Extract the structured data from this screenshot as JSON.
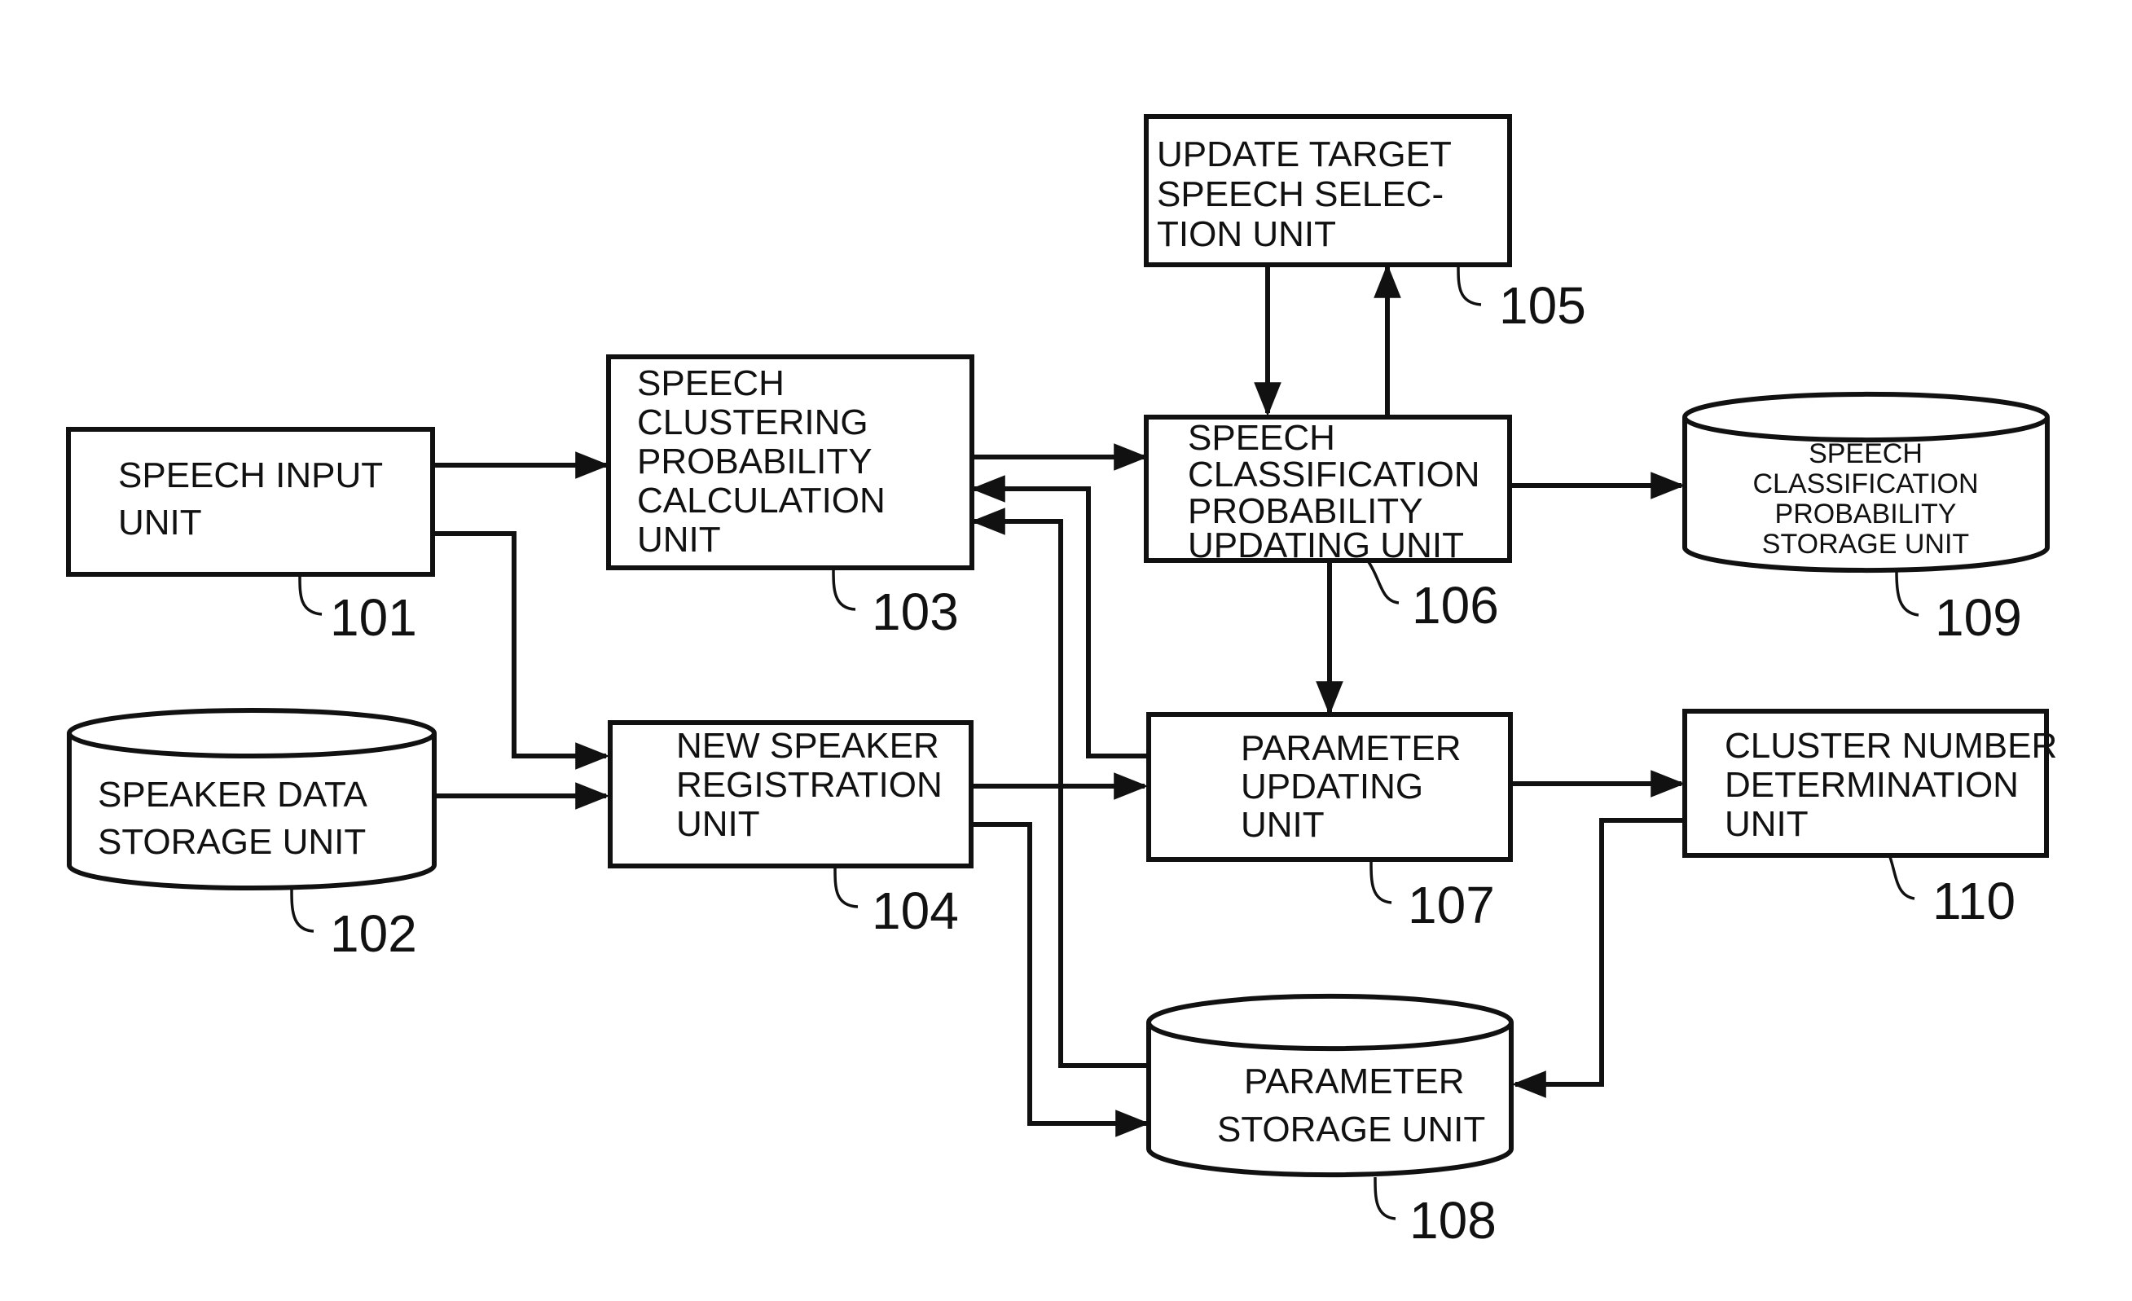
{
  "diagram": {
    "type": "block-diagram",
    "units": [
      {
        "id": "101",
        "shape": "rect",
        "lines": [
          "SPEECH INPUT",
          "UNIT"
        ]
      },
      {
        "id": "102",
        "shape": "cylinder",
        "lines": [
          "SPEAKER DATA",
          "STORAGE UNIT"
        ]
      },
      {
        "id": "103",
        "shape": "rect",
        "lines": [
          "SPEECH",
          "CLUSTERING",
          "PROBABILITY",
          "CALCULATION",
          "UNIT"
        ]
      },
      {
        "id": "104",
        "shape": "rect",
        "lines": [
          "NEW SPEAKER",
          "REGISTRATION",
          "UNIT"
        ]
      },
      {
        "id": "105",
        "shape": "rect",
        "lines": [
          "UPDATE TARGET",
          "SPEECH SELEC-",
          "TION UNIT"
        ]
      },
      {
        "id": "106",
        "shape": "rect",
        "lines": [
          "SPEECH",
          "CLASSIFICATION",
          "PROBABILITY",
          "UPDATING UNIT"
        ]
      },
      {
        "id": "107",
        "shape": "rect",
        "lines": [
          "PARAMETER",
          "UPDATING",
          "UNIT"
        ]
      },
      {
        "id": "108",
        "shape": "cylinder",
        "lines": [
          "PARAMETER",
          "STORAGE UNIT"
        ]
      },
      {
        "id": "109",
        "shape": "cylinder",
        "lines": [
          "SPEECH",
          "CLASSIFICATION",
          "PROBABILITY",
          "STORAGE UNIT"
        ]
      },
      {
        "id": "110",
        "shape": "rect",
        "lines": [
          "CLUSTER NUMBER",
          "DETERMINATION",
          "UNIT"
        ]
      }
    ],
    "connections": [
      {
        "from": "101",
        "to": "103"
      },
      {
        "from": "101",
        "to": "104"
      },
      {
        "from": "102",
        "to": "104"
      },
      {
        "from": "103",
        "to": "106"
      },
      {
        "from": "106",
        "to": "105"
      },
      {
        "from": "105",
        "to": "106"
      },
      {
        "from": "106",
        "to": "109"
      },
      {
        "from": "106",
        "to": "107"
      },
      {
        "from": "107",
        "to": "103"
      },
      {
        "from": "108",
        "to": "103"
      },
      {
        "from": "104",
        "to": "107"
      },
      {
        "from": "104",
        "to": "108"
      },
      {
        "from": "107",
        "to": "110"
      },
      {
        "from": "110",
        "to": "108"
      }
    ]
  }
}
